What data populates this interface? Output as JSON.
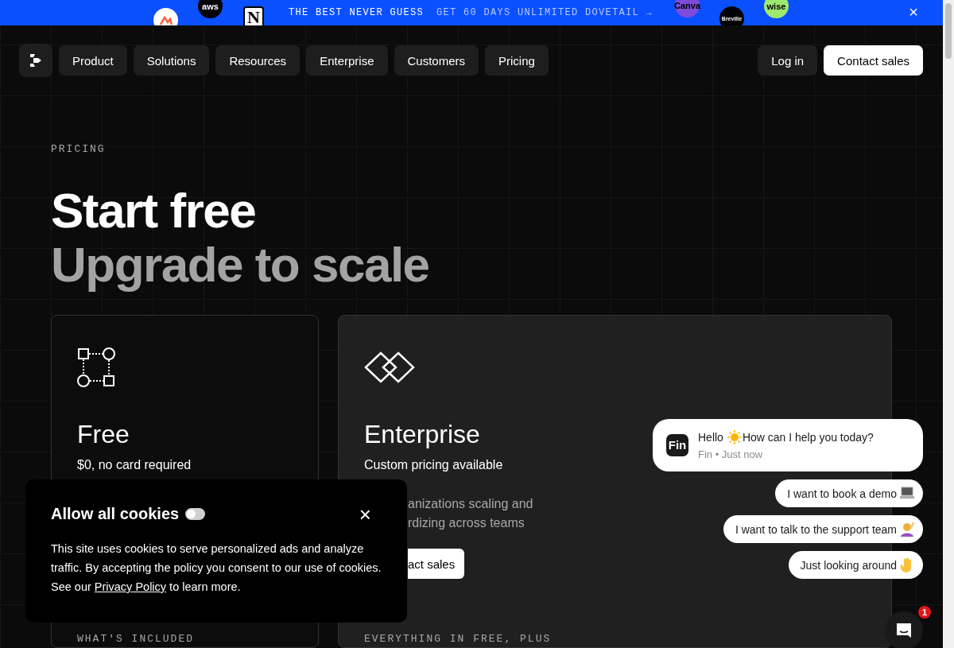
{
  "announcement": {
    "headline": "THE BEST NEVER GUESS",
    "offer": "GET 60 DAYS UNLIMITED DOVETAIL →",
    "close": "×",
    "logos": [
      {
        "kind": "circle",
        "color": "#ffffff"
      },
      {
        "kind": "circle",
        "label": "aws",
        "color": "#000000"
      },
      {
        "kind": "square",
        "label": "N",
        "color": "#ffffff"
      },
      {
        "kind": "circle",
        "label": "Canva",
        "color": "#7d4cdb"
      },
      {
        "kind": "circle",
        "label": "Breville",
        "color": "#000000"
      },
      {
        "kind": "circle",
        "label": "wise",
        "color": "#9fe870"
      }
    ]
  },
  "nav": {
    "items": [
      "Product",
      "Solutions",
      "Resources",
      "Enterprise",
      "Customers",
      "Pricing"
    ],
    "login": "Log in",
    "cta": "Contact sales"
  },
  "hero": {
    "eyebrow": "PRICING",
    "title": "Start free",
    "subtitle": "Upgrade to scale"
  },
  "plans": [
    {
      "kind": "free",
      "name": "Free",
      "price": "$0, no card required",
      "section": "WHAT'S INCLUDED"
    },
    {
      "kind": "enterprise",
      "name": "Enterprise",
      "price": "Custom pricing available",
      "description": [
        "anizations scaling and",
        "rdizing across teams"
      ],
      "button": "act sales",
      "section": "EVERYTHING IN FREE, PLUS"
    }
  ],
  "cookie": {
    "title": "Allow all cookies",
    "toggle_on": false,
    "close": "×",
    "text_before": "This site uses cookies to serve personalized ads and analyze traffic. By accepting the policy you consent to our use of cookies. See our ",
    "link": "Privacy Policy",
    "text_after": " to learn more."
  },
  "chat": {
    "avatar": "Fin",
    "greeting": [
      "Hello",
      "How can I help you today?"
    ],
    "meta": "Fin • Just now",
    "replies": [
      {
        "label": "I want to book a demo",
        "kind": "laptop"
      },
      {
        "label": "I want to talk to the support team",
        "kind": "person"
      },
      {
        "label": "Just looking around",
        "kind": "wave"
      }
    ],
    "badge": "1"
  }
}
